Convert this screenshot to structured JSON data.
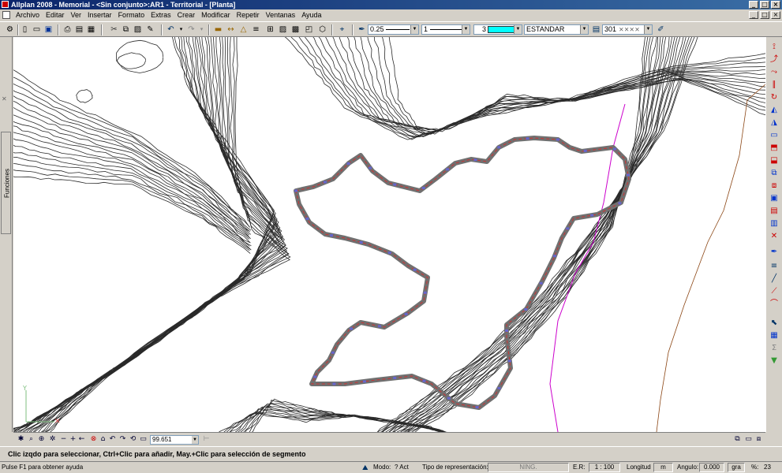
{
  "window": {
    "title": "Allplan 2008 - Memorial - <Sin conjunto>:AR1 - Territorial - [Planta]",
    "minimize": "_",
    "maximize": "□",
    "close": "×"
  },
  "menu": {
    "items": [
      "Archivo",
      "Editar",
      "Ver",
      "Insertar",
      "Formato",
      "Extras",
      "Crear",
      "Modificar",
      "Repetir",
      "Ventanas",
      "Ayuda"
    ]
  },
  "toolbar": {
    "pen_thickness": "0.25",
    "line_type": "1",
    "color_index": "3",
    "color_hex": "#00ffff",
    "layer": "ESTANDAR",
    "hatch_style": "301"
  },
  "left_panel": {
    "tab_label": "Funciones"
  },
  "view": {
    "zoom_value": "99.651"
  },
  "prompt_line": "Clic izqdo para seleccionar, Ctrl+Clic para añadir, May.+Clic para selección de segmento",
  "status": {
    "help": "Pulse F1 para obtener ayuda",
    "mode_label": "Modo:",
    "mode_value": "? Act",
    "repr_label": "Tipo de representación:",
    "repr_value": "NING.",
    "scale_label": "E.R:",
    "scale_value": "1 : 100",
    "length_label": "Longitud",
    "length_unit": "m",
    "angle_label": "Angulo:",
    "angle_value": "0.000",
    "angle_unit": "gra",
    "percent_label": "%:",
    "percent_value": "23"
  },
  "colors": {
    "selection": "#707070",
    "plot_boundary": "#cc00cc",
    "contour": "#222222",
    "accent_red": "#cc0000"
  }
}
